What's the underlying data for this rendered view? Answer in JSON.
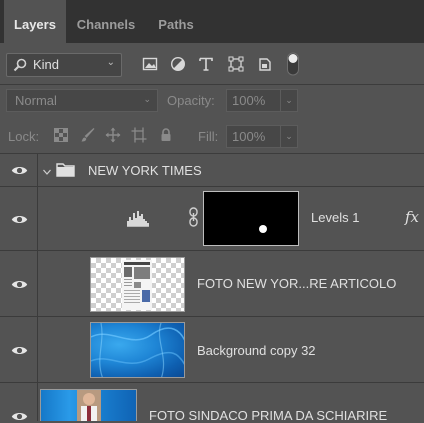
{
  "tabs": [
    "Layers",
    "Channels",
    "Paths"
  ],
  "filter": {
    "kind_label": "Kind"
  },
  "blend": {
    "mode": "Normal",
    "opacity_label": "Opacity:",
    "opacity_value": "100%"
  },
  "lock": {
    "label": "Lock:",
    "fill_label": "Fill:",
    "fill_value": "100%"
  },
  "layers": {
    "group": "NEW YORK TIMES",
    "levels": "Levels 1",
    "foto_articolo": "FOTO NEW YOR...RE ARTICOLO",
    "background_copy": "Background copy 32",
    "foto_sindaco": "FOTO SINDACO PRIMA DA SCHIARIRE"
  },
  "icons": {
    "layer_effects": "fx",
    "search": "search-icon",
    "filter_pixel": "image-icon",
    "filter_adjustment": "half-circle-icon",
    "filter_type": "type-icon",
    "filter_shape": "shape-icon",
    "filter_smart": "smart-object-icon",
    "filter_toggle": "toggle-icon"
  },
  "colors": {
    "panel": "#535353",
    "tabbar": "#323232",
    "text": "#e0e0e0",
    "muted": "#8a8a8a"
  }
}
